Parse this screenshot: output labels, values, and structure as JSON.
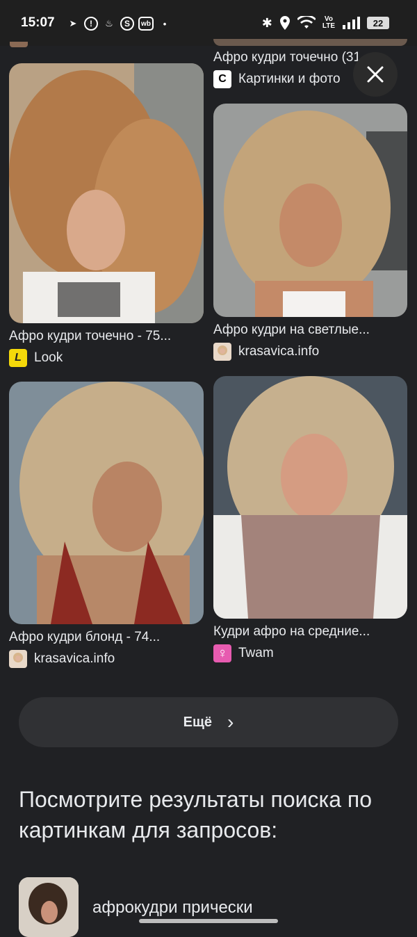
{
  "status_bar": {
    "time": "15:07",
    "battery": "22"
  },
  "results": [
    {
      "title": "Афро кудри точечно (31...",
      "source": "Картинки и фото",
      "favicon_text": "C"
    },
    {
      "title": "Афро кудри точечно - 75...",
      "source": "Look",
      "favicon_text": "L"
    },
    {
      "title": "Афро кудри на светлые...",
      "source": "krasavica.info",
      "favicon_text": ""
    },
    {
      "title": "Афро кудри блонд - 74...",
      "source": "krasavica.info",
      "favicon_text": ""
    },
    {
      "title": "Кудри афро на средние...",
      "source": "Twam",
      "favicon_text": "♀"
    }
  ],
  "more_button": {
    "label": "Ещё",
    "chevron": "›"
  },
  "section_heading": "Посмотрите результаты поиска по картинкам для запросов:",
  "related": [
    {
      "label": "афрокудри прически"
    }
  ],
  "colors": {
    "background": "#202124",
    "look_yellow": "#f5d90a",
    "twam_pink": "#e75bb0"
  }
}
